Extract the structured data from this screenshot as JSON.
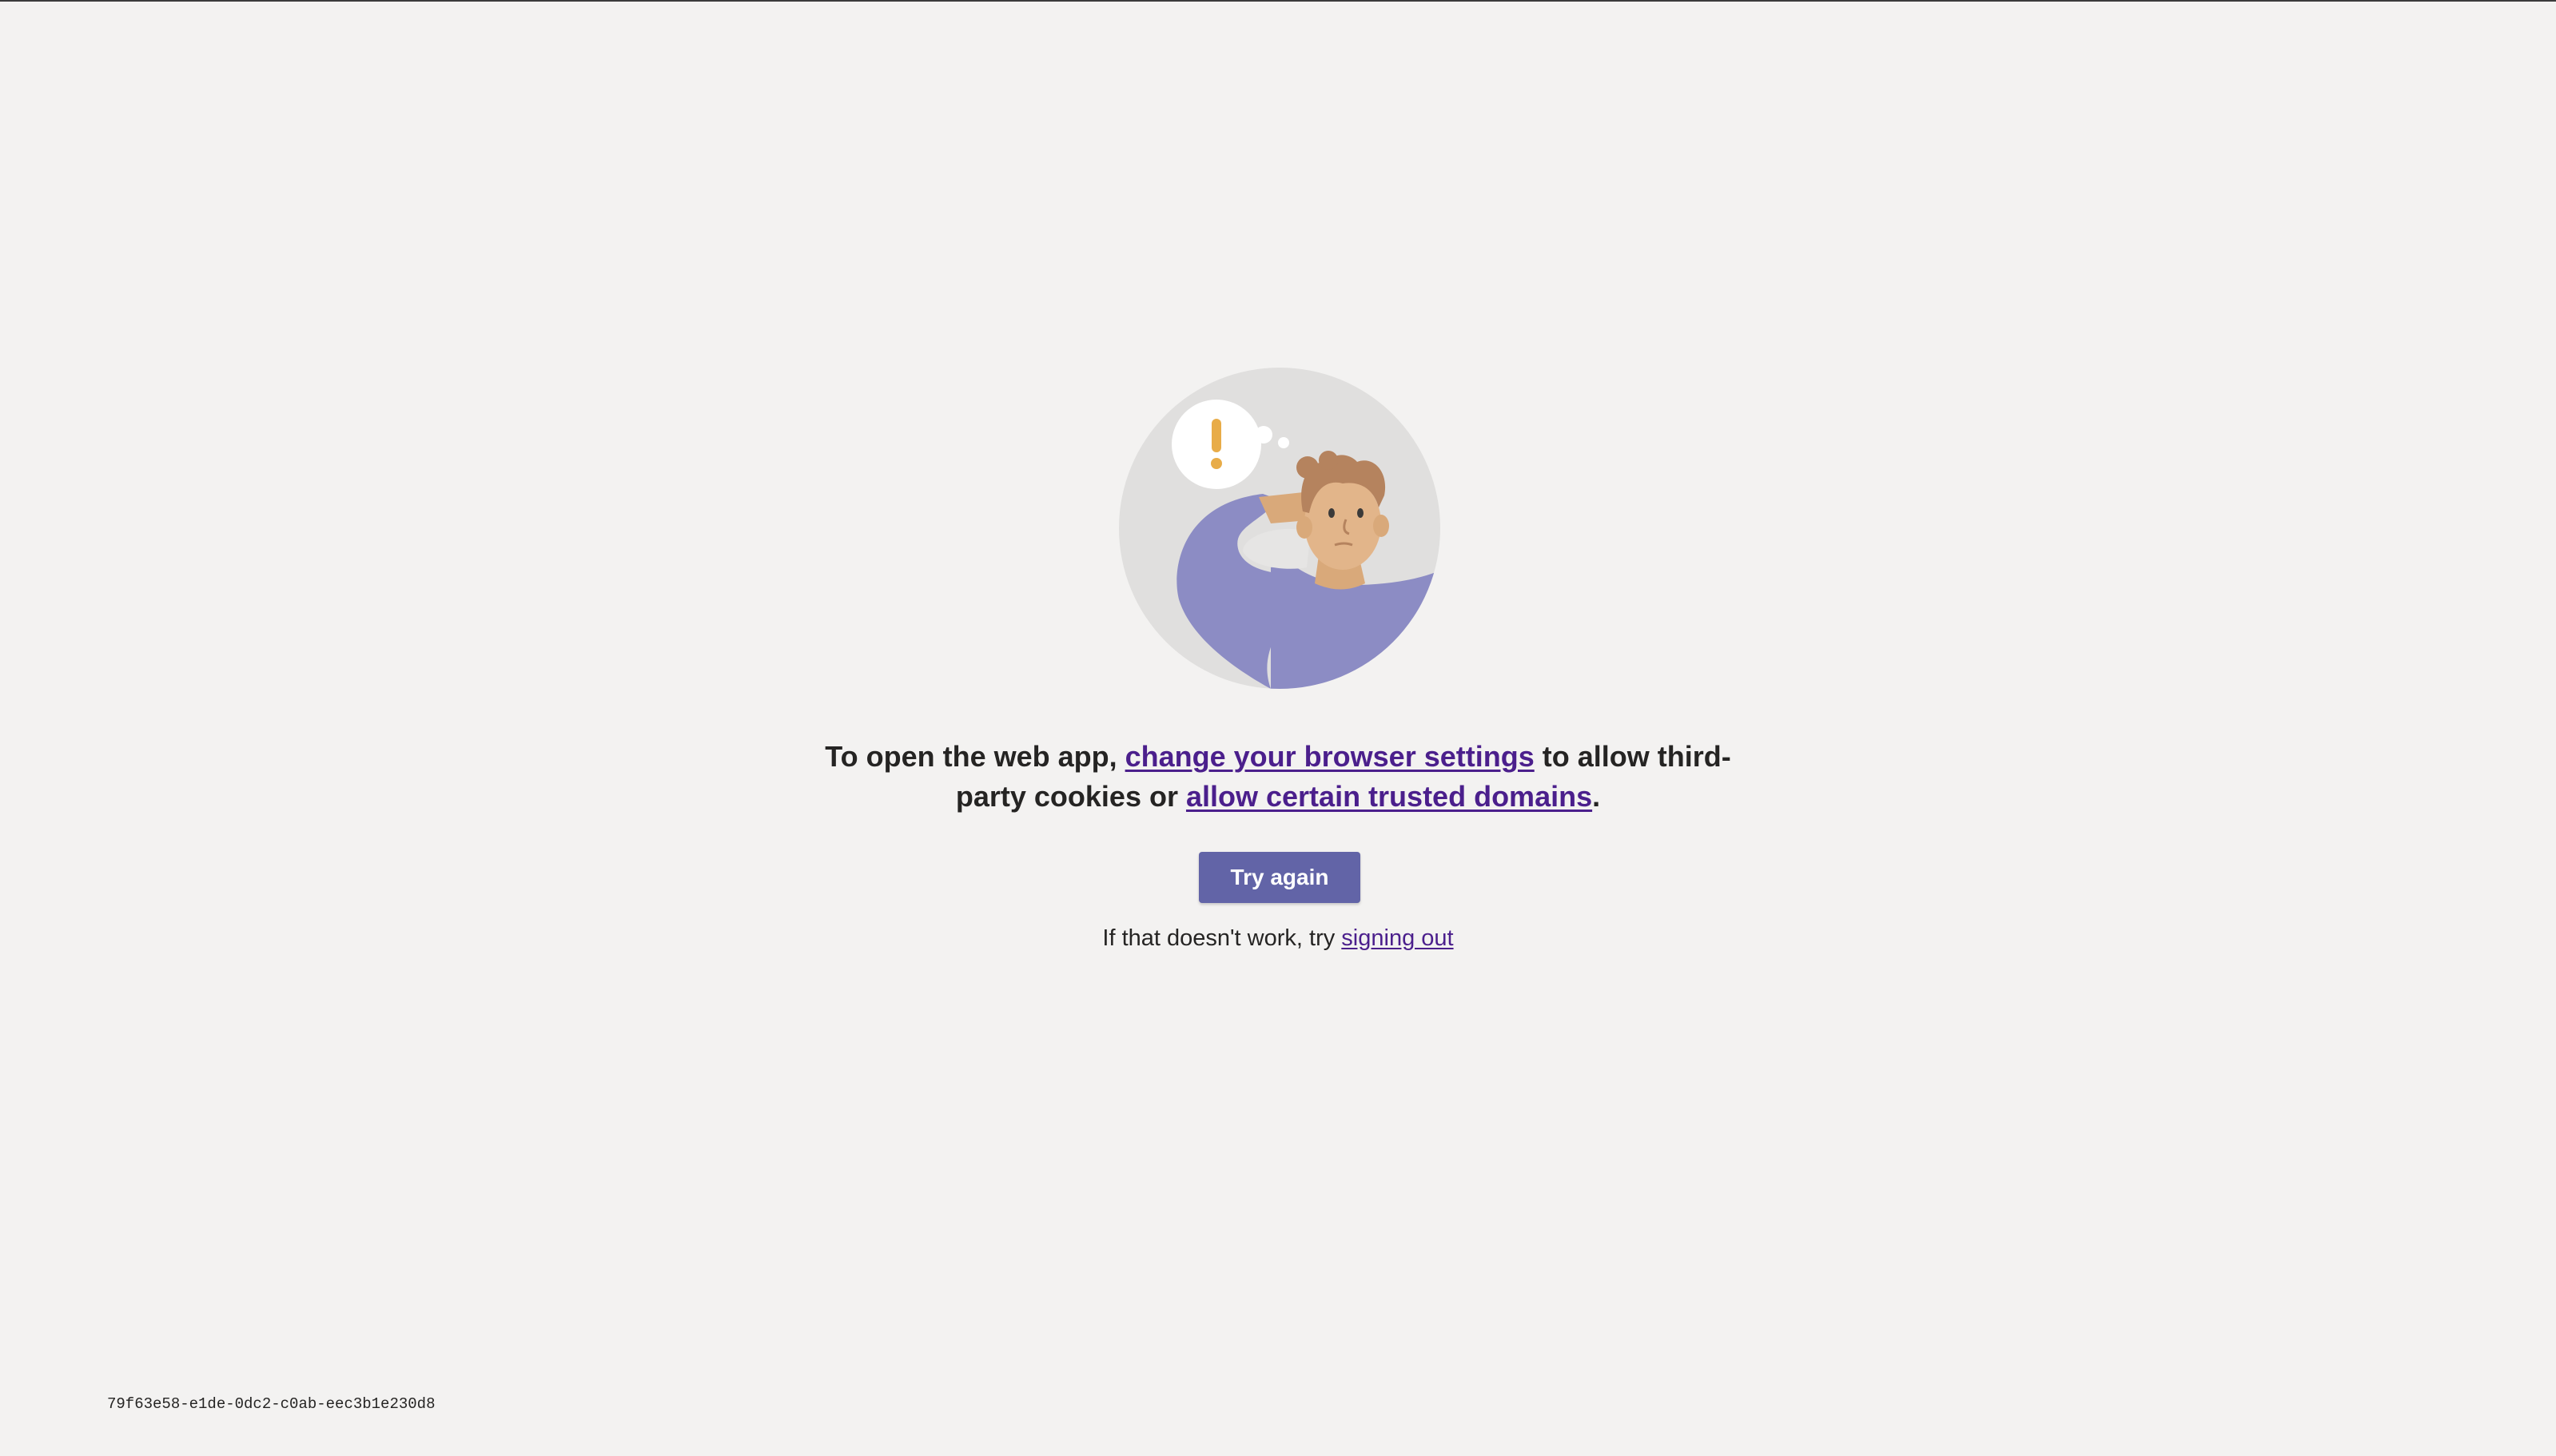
{
  "message": {
    "prefix": "To open the web app, ",
    "link1": "change your browser settings",
    "middle": " to allow third-party cookies or ",
    "link2": "allow certain trusted domains",
    "suffix": "."
  },
  "button": {
    "label": "Try again"
  },
  "hint": {
    "prefix": "If that doesn't work, try ",
    "link": "signing out"
  },
  "footer": {
    "session_id": "79f63e58-e1de-0dc2-c0ab-eec3b1e230d8"
  },
  "colors": {
    "background": "#f3f2f1",
    "accent": "#6264a7",
    "link": "#4b1f8c",
    "exclamation": "#e8ac48",
    "shirt": "#8c8cc4"
  }
}
